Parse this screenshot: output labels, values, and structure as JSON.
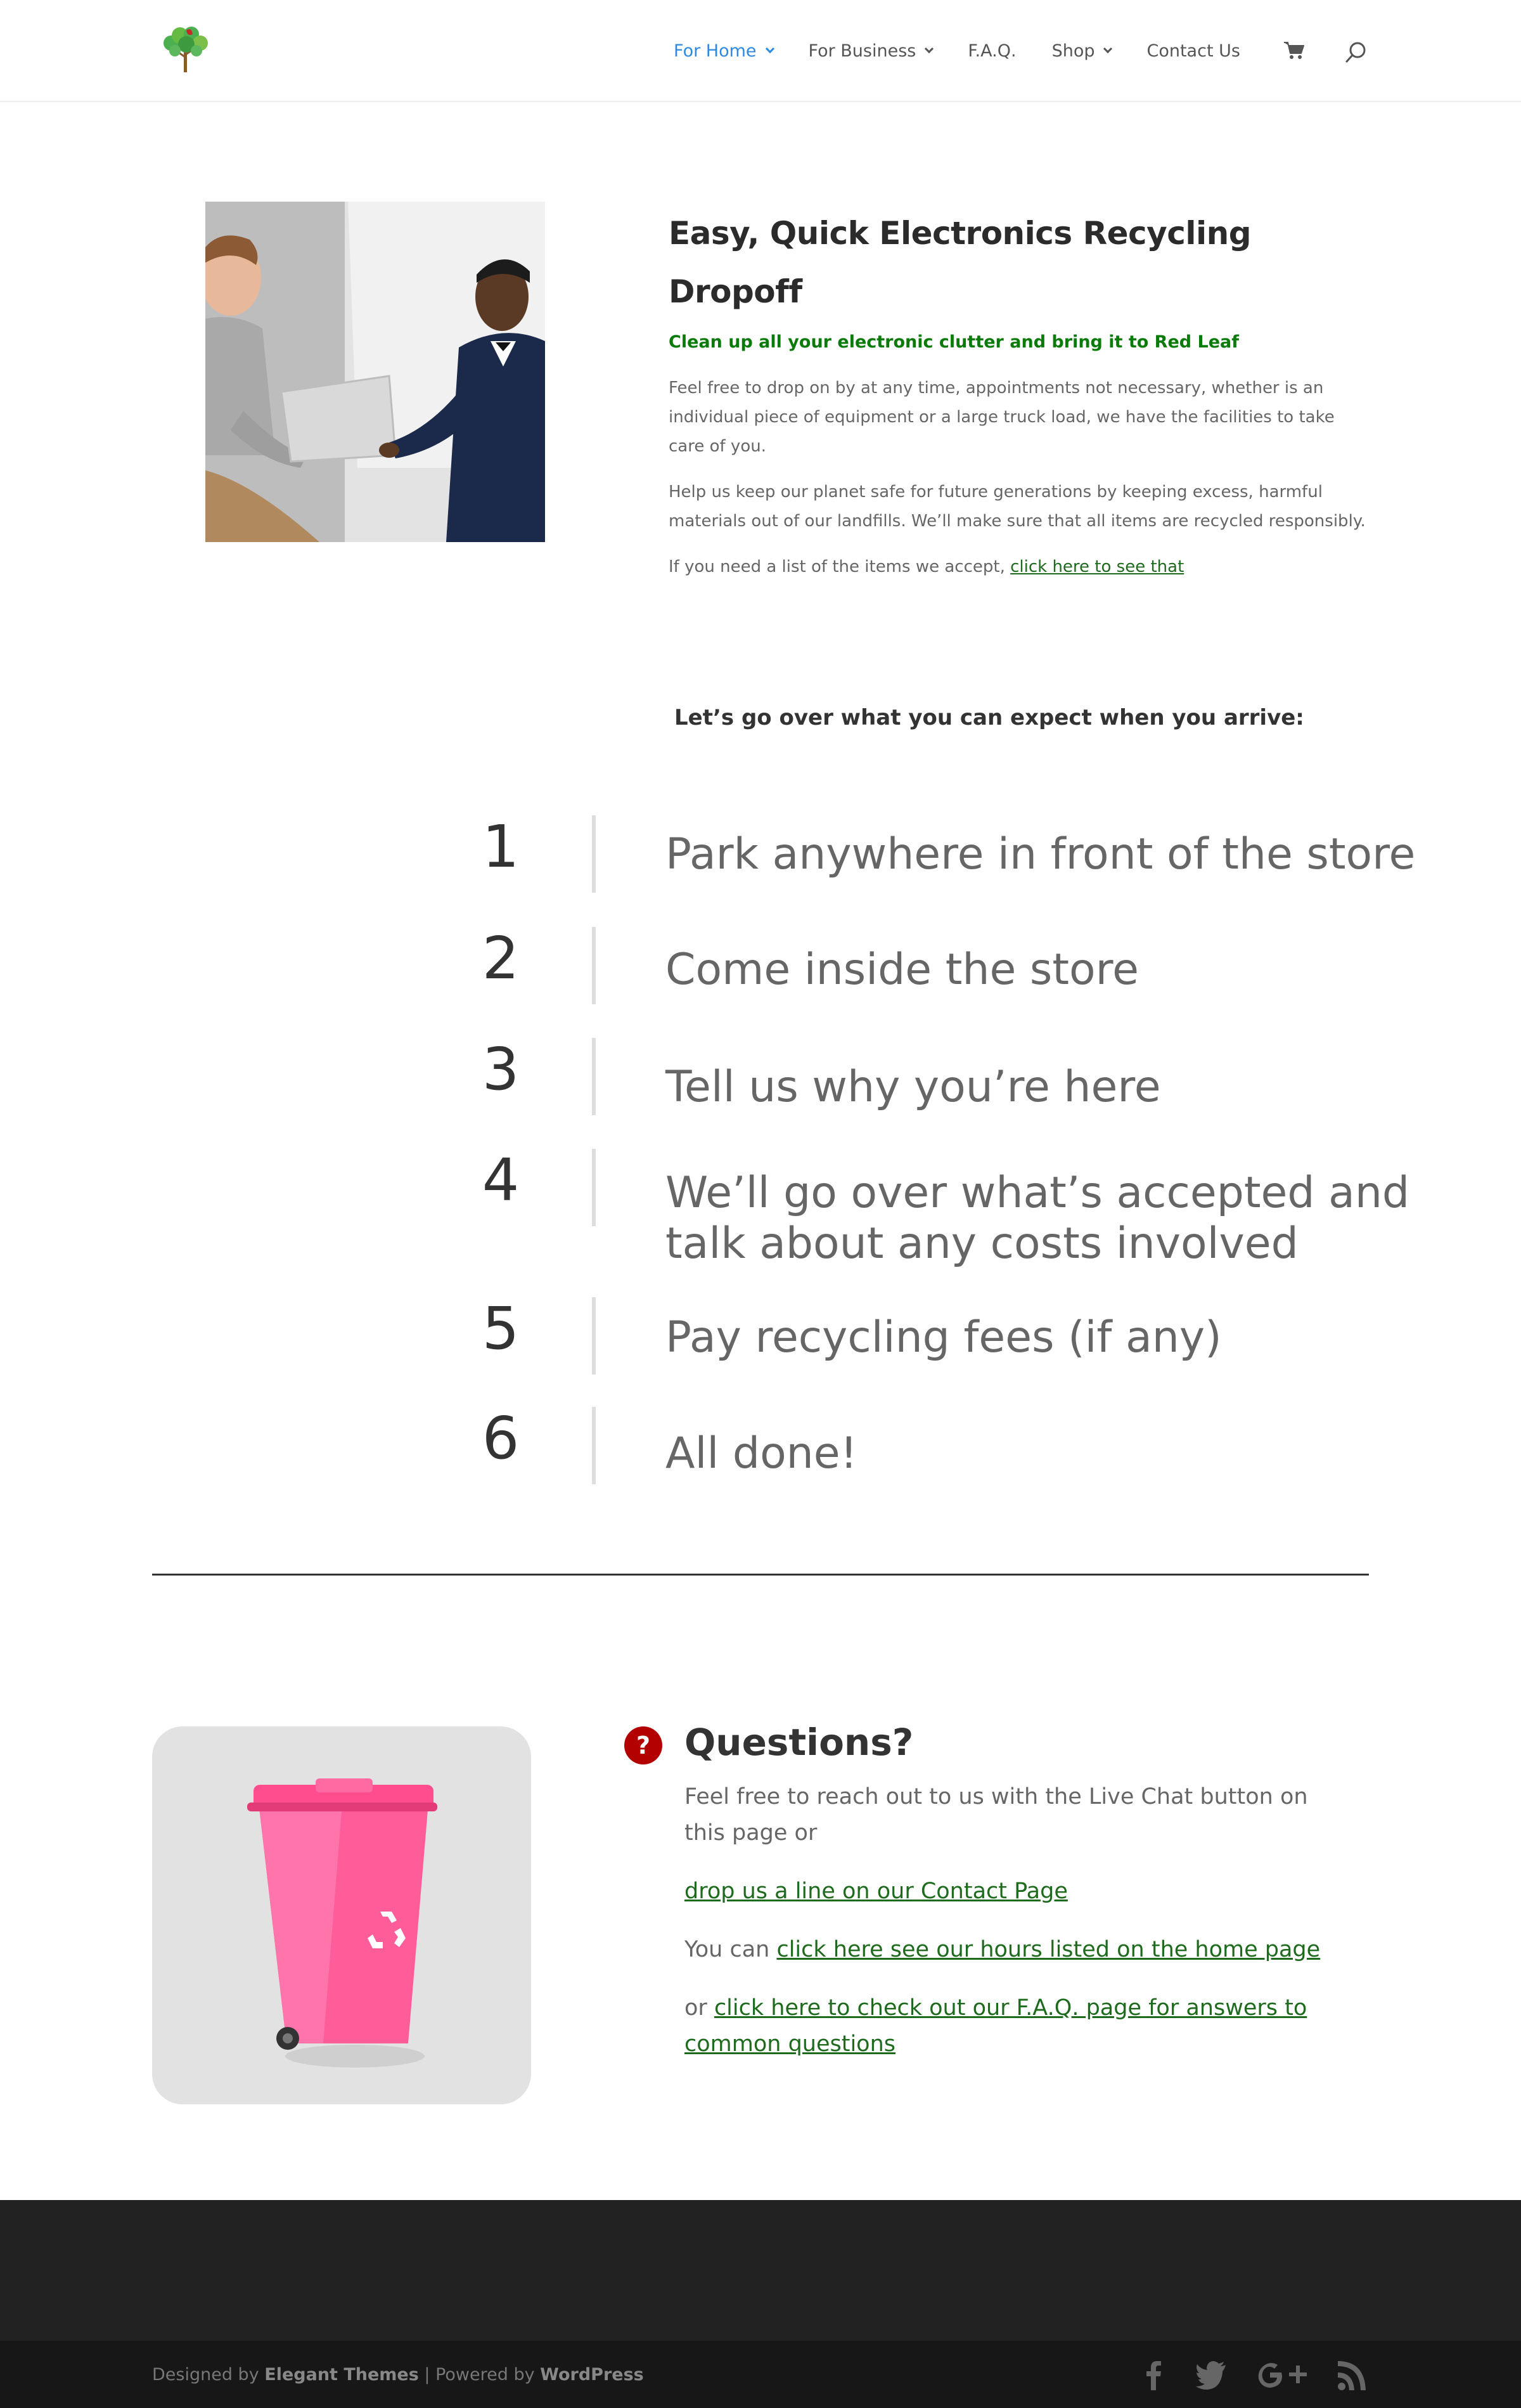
{
  "header": {
    "logo_icon": "tree-logo-icon",
    "nav": [
      {
        "label": "For Home",
        "has_dropdown": true,
        "active": true
      },
      {
        "label": "For Business",
        "has_dropdown": true,
        "active": false
      },
      {
        "label": "F.A.Q.",
        "has_dropdown": false,
        "active": false
      },
      {
        "label": "Shop",
        "has_dropdown": true,
        "active": false
      },
      {
        "label": "Contact Us",
        "has_dropdown": false,
        "active": false
      }
    ],
    "cart_icon": "cart-icon",
    "search_icon": "search-icon",
    "active_color": "#2e8ae0"
  },
  "intro": {
    "title": "Easy, Quick Electronics Recycling Dropoff",
    "subtitle": "Clean up all your electronic clutter and bring it to Red Leaf",
    "para1": "Feel free to drop on by at any time, appointments not necessary, whether is an individual piece of equipment or a large truck load, we have the facilities to take care of you.",
    "para2": "Help us keep our planet safe for future generations by keeping excess, harmful materials out of our landfills. We’ll make sure that all items are recycled responsibly.",
    "para3_prefix": "If you need a list of the items we accept, ",
    "para3_link": "click here to see that",
    "accent_color": "#0a7a0a"
  },
  "expect_heading": "Let’s go over what you can expect when you arrive:",
  "steps": [
    {
      "num": "1",
      "text": "Park anywhere in front of the store"
    },
    {
      "num": "2",
      "text": "Come inside the store"
    },
    {
      "num": "3",
      "text": "Tell us why you’re here"
    },
    {
      "num": "4",
      "text_line1": "We’ll go over what’s accepted and",
      "text_line2": "talk about any costs involved"
    },
    {
      "num": "5",
      "text": "Pay recycling fees (if any)"
    },
    {
      "num": "6",
      "text": "All done!"
    }
  ],
  "questions": {
    "icon": "question-icon",
    "title": "Questions?",
    "line1": "Feel free to reach out to us with the Live Chat button on this page or",
    "link_contact": "drop us a line on our Contact Page",
    "hours_prefix": "You can ",
    "link_hours": "click here see our hours listed on the home page",
    "faq_prefix": "or ",
    "link_faq": "click here to check out our F.A.Q. page for answers to common questions",
    "icon_color": "#b30000"
  },
  "footer": {
    "designed_by": "Designed by ",
    "elegant": "Elegant Themes",
    "sep": " | Powered by ",
    "wordpress": "WordPress",
    "social": [
      "facebook-icon",
      "twitter-icon",
      "google-plus-icon",
      "rss-icon"
    ]
  }
}
